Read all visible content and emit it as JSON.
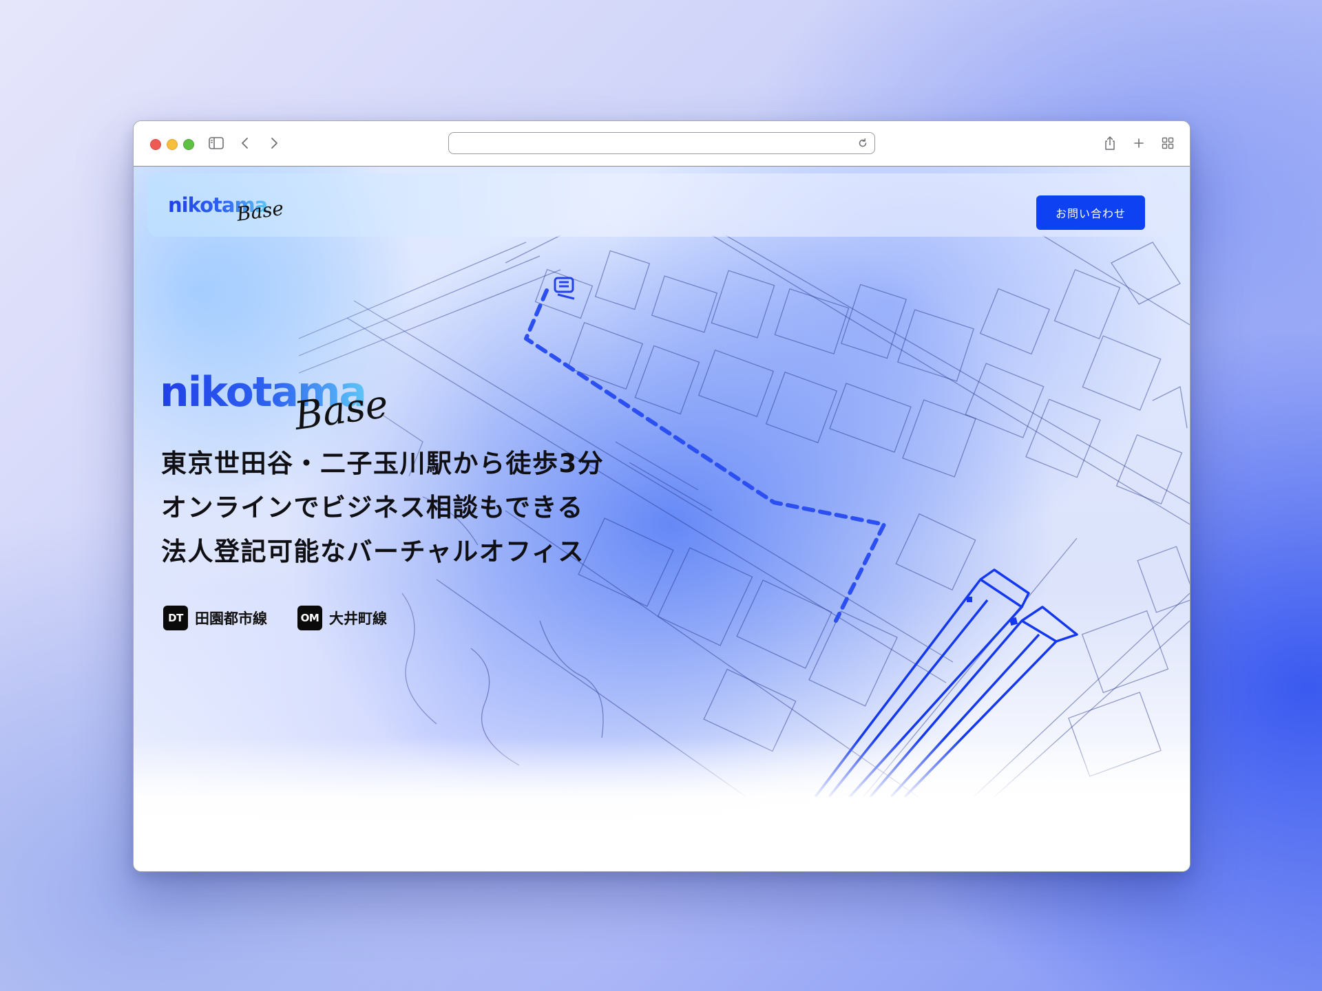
{
  "browser": {
    "address_value": "",
    "icons": [
      "sidebar-icon",
      "back-icon",
      "forward-icon",
      "reload-icon",
      "share-icon",
      "new-tab-icon",
      "tab-overview-icon"
    ]
  },
  "header": {
    "logo_main": "nikotama",
    "logo_script": "Base",
    "contact_label": "お問い合わせ"
  },
  "hero": {
    "logo_main": "nikotama",
    "logo_script": "Base",
    "headline": [
      "東京世田谷・二子玉川駅から徒歩3分",
      "オンラインでビジネス相談もできる",
      "法人登記可能なバーチャルオフィス"
    ],
    "lines": [
      {
        "code": "DT",
        "name": "田園都市線"
      },
      {
        "code": "OM",
        "name": "大井町線"
      }
    ]
  },
  "colors": {
    "accent": "#0e41f1",
    "map_line": "#1a2a8a",
    "route": "#2b4ff0"
  }
}
